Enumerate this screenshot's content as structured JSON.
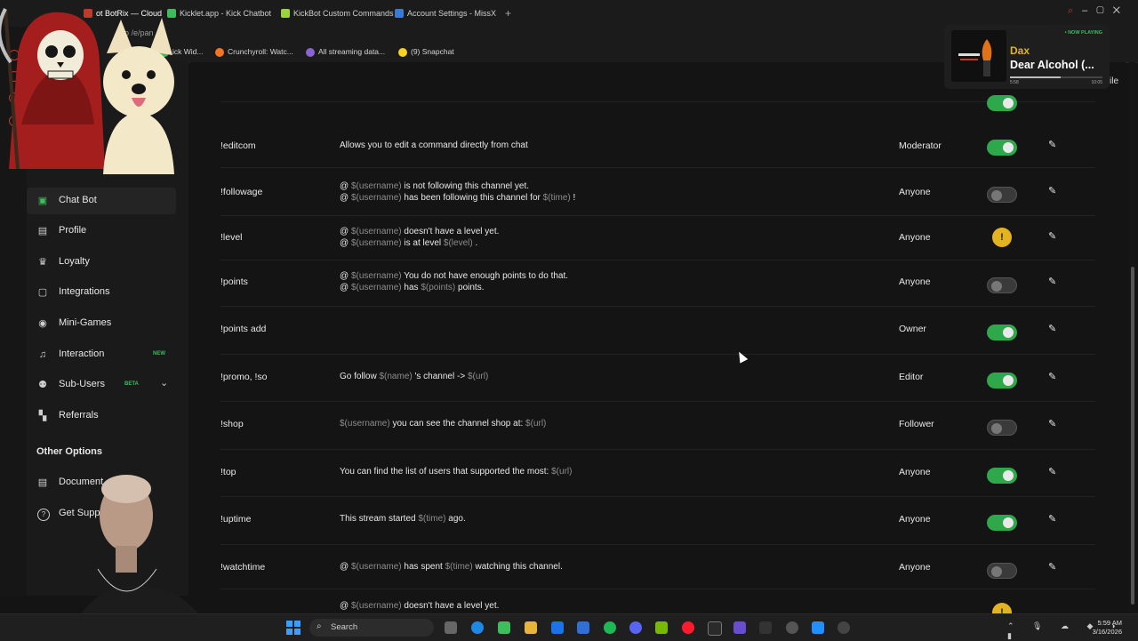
{
  "browser": {
    "tabs": [
      {
        "label": "ot BotRix — Cloud",
        "color": "#c0392b",
        "active": true
      },
      {
        "label": "Kicklet.app - Kick Chatbot",
        "color": "#3ebd5c",
        "active": false
      },
      {
        "label": "KickBot Custom Commands",
        "color": "#9bd43a",
        "active": false
      },
      {
        "label": "Account Settings - MissX",
        "color": "#3a7bd5",
        "active": false
      }
    ],
    "new_tab": "+",
    "address_fragment": "o  /e/pan",
    "bookmarks": [
      {
        "label": "ick Wid...",
        "color": "#3ebd5c"
      },
      {
        "label": "Crunchyroll: Watc...",
        "color": "#f47521"
      },
      {
        "label": "All streaming data...",
        "color": "#8a63d2"
      },
      {
        "label": "(9) Snapchat",
        "color": "#f7d21e"
      }
    ]
  },
  "sidebar": {
    "items": [
      {
        "label": "Chat Bot",
        "icon": "robot-icon",
        "glyph": "▣",
        "active": true
      },
      {
        "label": "Profile",
        "icon": "profile-card-icon",
        "glyph": "▤"
      },
      {
        "label": "Loyalty",
        "icon": "trophy-icon",
        "glyph": "♛"
      },
      {
        "label": "Integrations",
        "icon": "integrations-icon",
        "glyph": "▢"
      },
      {
        "label": "Mini-Games",
        "icon": "gamepad-icon",
        "glyph": "◉"
      },
      {
        "label": "Interaction",
        "icon": "music-note-icon",
        "glyph": "♫",
        "badge": "NEW"
      },
      {
        "label": "Sub-Users",
        "icon": "users-icon",
        "glyph": "⚉",
        "badge": "BETA",
        "expand": "⌄"
      },
      {
        "label": "Referrals",
        "icon": "referral-icon",
        "glyph": "▚"
      }
    ],
    "other_heading": "Other Options",
    "other_items": [
      {
        "label": "Document",
        "icon": "document-icon",
        "glyph": "▤"
      },
      {
        "label": "Get Supp",
        "icon": "help-icon",
        "glyph": "?"
      }
    ]
  },
  "commands": [
    {
      "name": "!editcom",
      "response": [
        [
          {
            "t": "Allows you to edit a command directly from chat"
          }
        ]
      ],
      "role": "Moderator",
      "state": "on"
    },
    {
      "name": "!followage",
      "response": [
        [
          {
            "t": "@ "
          },
          {
            "t": "$(username)",
            "v": true
          },
          {
            "t": "  is not following this channel yet."
          }
        ],
        [
          {
            "t": "@ "
          },
          {
            "t": "$(username)",
            "v": true
          },
          {
            "t": "  has been following this channel for  "
          },
          {
            "t": "$(time)",
            "v": true
          },
          {
            "t": "  !"
          }
        ]
      ],
      "role": "Anyone",
      "state": "off"
    },
    {
      "name": "!level",
      "response": [
        [
          {
            "t": "@ "
          },
          {
            "t": "$(username)",
            "v": true
          },
          {
            "t": "  doesn't have a level yet."
          }
        ],
        [
          {
            "t": "@ "
          },
          {
            "t": "$(username)",
            "v": true
          },
          {
            "t": "  is at level  "
          },
          {
            "t": "$(level)",
            "v": true
          },
          {
            "t": "  ."
          }
        ]
      ],
      "role": "Anyone",
      "state": "warn"
    },
    {
      "name": "!points",
      "response": [
        [
          {
            "t": "@ "
          },
          {
            "t": "$(username)",
            "v": true
          },
          {
            "t": "  You do not have enough points to do that."
          }
        ],
        [
          {
            "t": "@ "
          },
          {
            "t": "$(username)",
            "v": true
          },
          {
            "t": "  has  "
          },
          {
            "t": "$(points)",
            "v": true
          },
          {
            "t": "  points."
          }
        ]
      ],
      "role": "Anyone",
      "state": "off"
    },
    {
      "name": "!points add",
      "response": [],
      "role": "Owner",
      "state": "on"
    },
    {
      "name": "!promo, !so",
      "response": [
        [
          {
            "t": "Go follow  "
          },
          {
            "t": "$(name)",
            "v": true
          },
          {
            "t": "  's channel ->  "
          },
          {
            "t": "$(url)",
            "v": true
          }
        ]
      ],
      "role": "Editor",
      "state": "on"
    },
    {
      "name": "!shop",
      "response": [
        [
          {
            "t": " "
          },
          {
            "t": "$(username)",
            "v": true
          },
          {
            "t": "  you can see the channel shop at:  "
          },
          {
            "t": "$(url)",
            "v": true
          }
        ]
      ],
      "role": "Follower",
      "state": "off"
    },
    {
      "name": "!top",
      "response": [
        [
          {
            "t": "You can find the list of users that supported the most:  "
          },
          {
            "t": "$(url)",
            "v": true
          }
        ]
      ],
      "role": "Anyone",
      "state": "on"
    },
    {
      "name": "!uptime",
      "response": [
        [
          {
            "t": "This stream started  "
          },
          {
            "t": "$(time)",
            "v": true
          },
          {
            "t": "  ago."
          }
        ]
      ],
      "role": "Anyone",
      "state": "on"
    },
    {
      "name": "!watchtime",
      "response": [
        [
          {
            "t": "@ "
          },
          {
            "t": "$(username)",
            "v": true
          },
          {
            "t": "  has spent  "
          },
          {
            "t": "$(time)",
            "v": true
          },
          {
            "t": "  watching this channel."
          }
        ]
      ],
      "role": "Anyone",
      "state": "off"
    },
    {
      "name": "",
      "response": [
        [
          {
            "t": "@ "
          },
          {
            "t": "$(username)",
            "v": true
          },
          {
            "t": "  doesn't have a level yet."
          }
        ]
      ],
      "role": "",
      "state": "warn"
    }
  ],
  "now_playing": {
    "tag": "• NOW PLAYING",
    "artist": "Dax",
    "title": "Dear Alcohol (...",
    "elapsed": "5:58",
    "duration": "10:05",
    "progress": 0.55
  },
  "profile_clip": "ile",
  "taskbar": {
    "search_label": "Search",
    "time": "5:59 AM",
    "date": "3/16/2026",
    "tray": "⌃ 🎙 ☁ ◆ ◗ ▮"
  },
  "colors": {
    "accent": "#2ea84a",
    "warning": "#e3b321",
    "background": "#141414"
  }
}
